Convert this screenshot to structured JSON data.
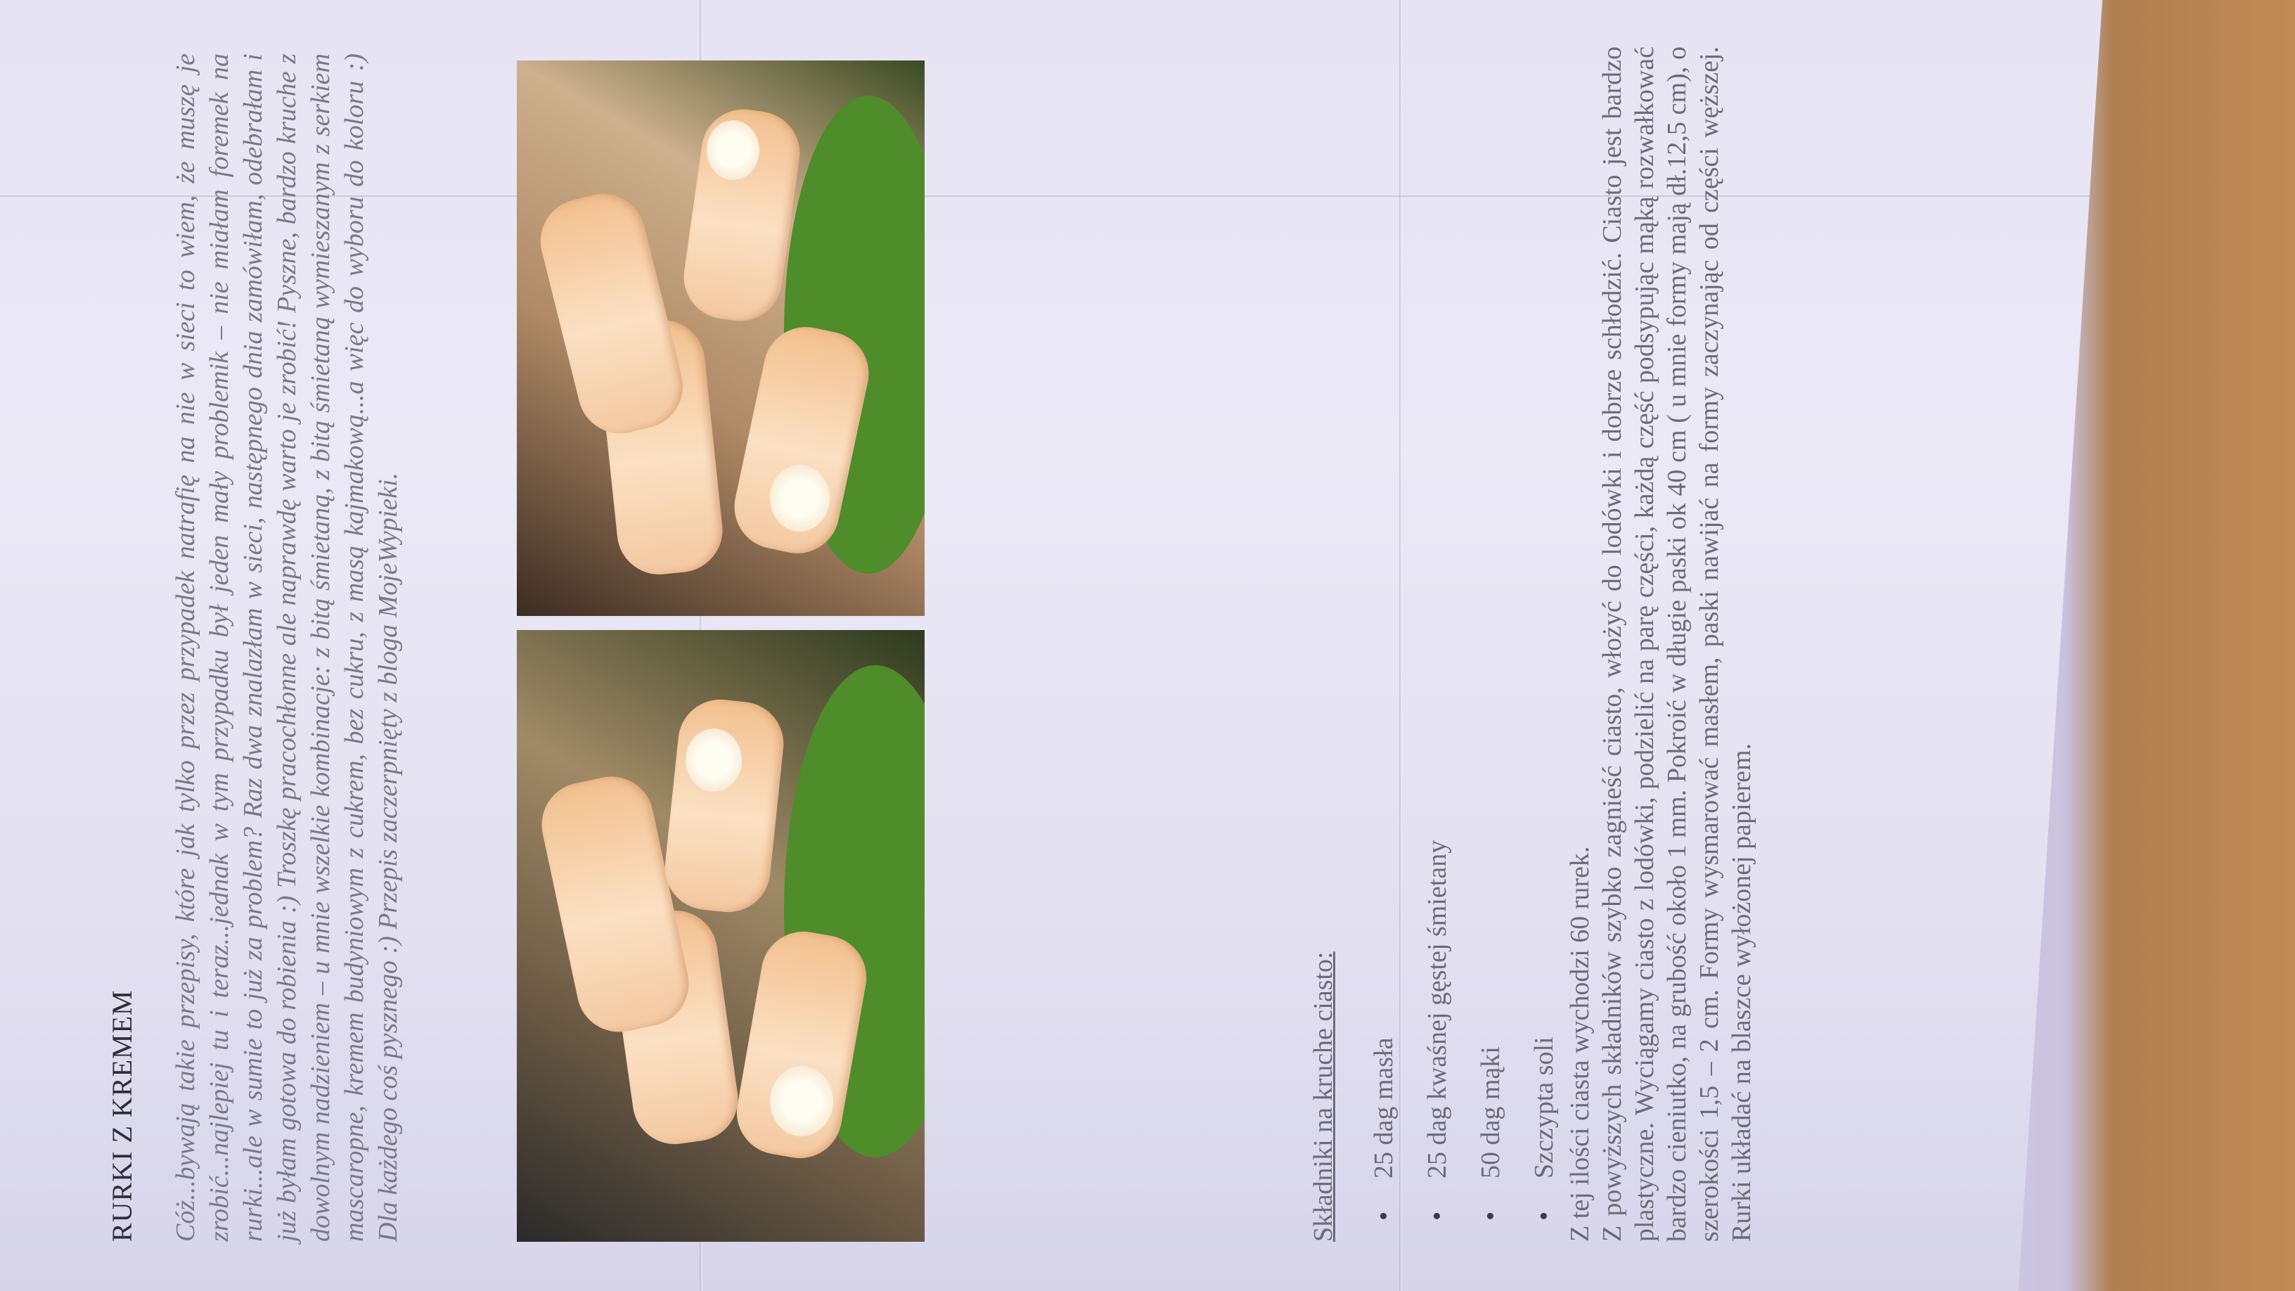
{
  "recipe": {
    "title": "RURKI Z KREMEM",
    "intro": "Cóż...bywają takie przepisy, które jak tylko przez przypadek natrafię na nie w sieci to wiem, że muszę je zrobić...najlepiej tu i teraz...jednak w tym przypadku był jeden mały problemik – nie miałam foremek na rurki...ale w sumie to już za problem? Raz dwa znalazłam w sieci, następnego dnia zamówiłam, odebrałam i już byłam gotowa do robienia :) Troszkę pracochłonne ale naprawdę warto je zrobić! Pyszne, bardzo kruche z dowolnym nadzieniem – u mnie wszelkie kombinacje: z bitą śmietaną, z bitą śmietaną wymieszanym z serkiem mascaropne, kremem budyniowym z cukrem, bez cukru, z masą kajmakową...a więc do wyboru do koloru :) Dla każdego coś pysznego :) Przepis zaczerpnięty z bloga MojeWypieki.",
    "ingredients_heading": "Składniki na kruche ciasto:",
    "ingredients": [
      "25 dag masła",
      "25 dag kwaśnej gęstej śmietany",
      "50 dag mąki",
      "Szczypta soli"
    ],
    "yield": "Z tej ilości ciasta wychodzi 60 rurek.",
    "method": "Z powyższych składników szybko zagnieść ciasto, włożyć do lodówki i dobrze schłodzić. Ciasto jest bardzo plastyczne. Wyciągamy ciasto z lodówki, podzielić na parę części, każdą część podsypując mąką rozwałkować bardzo cieniutko, na grubość około 1 mm. Pokroić w długie paski ok 40 cm ( u mnie formy mają dł.12,5 cm), o szerokości 1,5 – 2 cm. Formy wysmarować masłem, paski nawijać na formy zaczynając od części węższej. Rurki układać na blaszce wyłożonej papierem."
  },
  "colors": {
    "paper": "#e6e4f4",
    "table_wood": "#b07f4f",
    "text": "#6a6877",
    "title": "#2e2d38"
  }
}
